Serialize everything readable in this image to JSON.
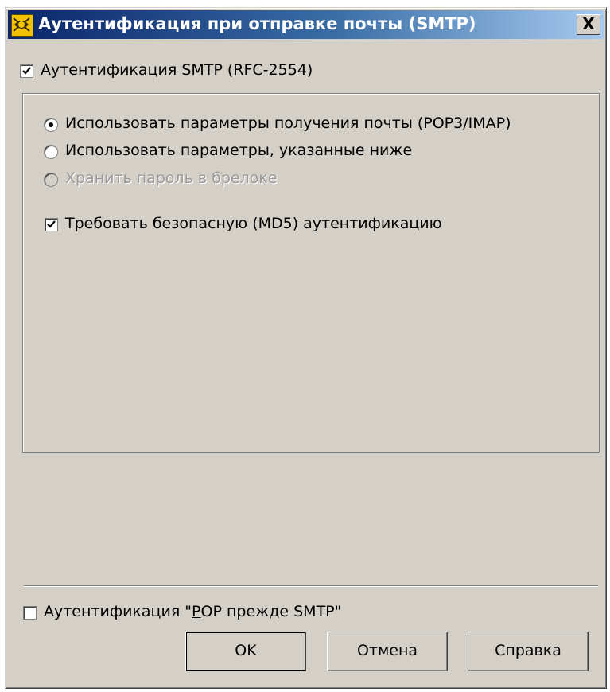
{
  "dialog": {
    "title": "Аутентификация при отправке почты (SMTP)",
    "close_label": "X"
  },
  "smtp_auth": {
    "checked": true,
    "label_pre": "Аутентификация ",
    "label_accel": "S",
    "label_post": "MTP (RFC-2554)"
  },
  "options": {
    "radio_use_receive": {
      "label": "Использовать параметры получения почты (POP3/IMAP)",
      "selected": true
    },
    "radio_use_below": {
      "label": "Использовать параметры, указанные ниже",
      "selected": false
    },
    "radio_keychain": {
      "label": "Хранить пароль в брелоке",
      "selected": false,
      "disabled": true
    },
    "md5_checkbox": {
      "label": "Требовать безопасную (MD5) аутентификацию",
      "checked": true
    }
  },
  "pop_before_smtp": {
    "checked": false,
    "label_pre": "Аутентификация \"",
    "label_accel": "P",
    "label_post": "OP прежде SMTP\""
  },
  "buttons": {
    "ok": "OK",
    "cancel": "Отмена",
    "help": "Справка"
  },
  "colors": {
    "face": "#d4d0c8",
    "title_start": "#0a246a",
    "title_end": "#a6caf0"
  }
}
